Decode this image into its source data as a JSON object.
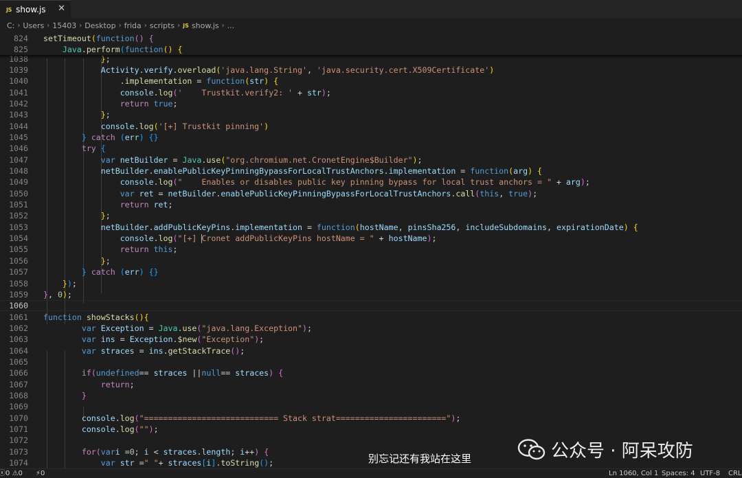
{
  "tab": {
    "badge": "JS",
    "label": "show.js",
    "close": "✕"
  },
  "breadcrumb": [
    "C:",
    "Users",
    "15403",
    "Desktop",
    "frida",
    "scripts",
    "show.js",
    "..."
  ],
  "sticky_lines": [
    {
      "no": "824",
      "tokens": [
        [
          "f",
          "setTimeout"
        ],
        [
          "b1",
          "("
        ],
        [
          "k",
          "function"
        ],
        [
          "b2",
          "()"
        ],
        [
          "p",
          " "
        ],
        [
          "b2",
          "{"
        ]
      ]
    },
    {
      "no": "825",
      "tokens": [
        [
          "p",
          "    "
        ],
        [
          "c",
          "Java"
        ],
        [
          "p",
          "."
        ],
        [
          "f",
          "perform"
        ],
        [
          "b3",
          "("
        ],
        [
          "k",
          "function"
        ],
        [
          "b1",
          "()"
        ],
        [
          "p",
          " "
        ],
        [
          "b1",
          "{"
        ]
      ]
    }
  ],
  "lines": [
    {
      "no": "1038",
      "tokens": [
        [
          "p",
          "            "
        ],
        [
          "b1",
          "}"
        ],
        [
          "p",
          ";"
        ]
      ]
    },
    {
      "no": "1039",
      "tokens": [
        [
          "p",
          "            "
        ],
        [
          "v",
          "Activity"
        ],
        [
          "p",
          "."
        ],
        [
          "v",
          "verify"
        ],
        [
          "p",
          "."
        ],
        [
          "f",
          "overload"
        ],
        [
          "b1",
          "("
        ],
        [
          "s",
          "'java.lang.String'"
        ],
        [
          "p",
          ", "
        ],
        [
          "s",
          "'java.security.cert.X509Certificate'"
        ],
        [
          "b1",
          ")"
        ]
      ]
    },
    {
      "no": "1040",
      "tokens": [
        [
          "p",
          "                ."
        ],
        [
          "f",
          "implementation"
        ],
        [
          "p",
          " = "
        ],
        [
          "k",
          "function"
        ],
        [
          "b1",
          "("
        ],
        [
          "v",
          "str"
        ],
        [
          "b1",
          ")"
        ],
        [
          "p",
          " "
        ],
        [
          "b1",
          "{"
        ]
      ]
    },
    {
      "no": "1041",
      "tokens": [
        [
          "p",
          "                "
        ],
        [
          "v",
          "console"
        ],
        [
          "p",
          "."
        ],
        [
          "f",
          "log"
        ],
        [
          "b2",
          "("
        ],
        [
          "s",
          "'    Trustkit.verify2: '"
        ],
        [
          "p",
          " + "
        ],
        [
          "v",
          "str"
        ],
        [
          "b2",
          ")"
        ],
        [
          "p",
          ";"
        ]
      ]
    },
    {
      "no": "1042",
      "tokens": [
        [
          "p",
          "                "
        ],
        [
          "ct",
          "return"
        ],
        [
          "p",
          " "
        ],
        [
          "k",
          "true"
        ],
        [
          "p",
          ";"
        ]
      ]
    },
    {
      "no": "1043",
      "tokens": [
        [
          "p",
          "            "
        ],
        [
          "b1",
          "}"
        ],
        [
          "p",
          ";"
        ]
      ]
    },
    {
      "no": "1044",
      "tokens": [
        [
          "p",
          "            "
        ],
        [
          "v",
          "console"
        ],
        [
          "p",
          "."
        ],
        [
          "f",
          "log"
        ],
        [
          "b1",
          "("
        ],
        [
          "s",
          "'[+] Trustkit pinning'"
        ],
        [
          "b1",
          ")"
        ]
      ]
    },
    {
      "no": "1045",
      "tokens": [
        [
          "p",
          "        "
        ],
        [
          "b3",
          "}"
        ],
        [
          "p",
          " "
        ],
        [
          "ct",
          "catch"
        ],
        [
          "p",
          " "
        ],
        [
          "b3",
          "("
        ],
        [
          "v",
          "err"
        ],
        [
          "b3",
          ")"
        ],
        [
          "p",
          " "
        ],
        [
          "b3",
          "{}"
        ]
      ]
    },
    {
      "no": "1046",
      "tokens": [
        [
          "p",
          "        "
        ],
        [
          "ct",
          "try"
        ],
        [
          "p",
          " "
        ],
        [
          "b3",
          "{"
        ]
      ]
    },
    {
      "no": "1047",
      "tokens": [
        [
          "p",
          "            "
        ],
        [
          "k",
          "var"
        ],
        [
          "p",
          " "
        ],
        [
          "v",
          "netBuilder"
        ],
        [
          "p",
          " = "
        ],
        [
          "c",
          "Java"
        ],
        [
          "p",
          "."
        ],
        [
          "f",
          "use"
        ],
        [
          "b1",
          "("
        ],
        [
          "s",
          "\"org.chromium.net.CronetEngine$Builder\""
        ],
        [
          "b1",
          ")"
        ],
        [
          "p",
          ";"
        ]
      ]
    },
    {
      "no": "1048",
      "tokens": [
        [
          "p",
          "            "
        ],
        [
          "v",
          "netBuilder"
        ],
        [
          "p",
          "."
        ],
        [
          "v",
          "enablePublicKeyPinningBypassForLocalTrustAnchors"
        ],
        [
          "p",
          "."
        ],
        [
          "v",
          "implementation"
        ],
        [
          "p",
          " = "
        ],
        [
          "k",
          "function"
        ],
        [
          "b1",
          "("
        ],
        [
          "v",
          "arg"
        ],
        [
          "b1",
          ")"
        ],
        [
          "p",
          " "
        ],
        [
          "b1",
          "{"
        ]
      ]
    },
    {
      "no": "1049",
      "tokens": [
        [
          "p",
          "                "
        ],
        [
          "v",
          "console"
        ],
        [
          "p",
          "."
        ],
        [
          "f",
          "log"
        ],
        [
          "b2",
          "("
        ],
        [
          "s",
          "\"    Enables or disables public key pinning bypass for local trust anchors = \""
        ],
        [
          "p",
          " + "
        ],
        [
          "v",
          "arg"
        ],
        [
          "b2",
          ")"
        ],
        [
          "p",
          ";"
        ]
      ]
    },
    {
      "no": "1050",
      "tokens": [
        [
          "p",
          "                "
        ],
        [
          "k",
          "var"
        ],
        [
          "p",
          " "
        ],
        [
          "v",
          "ret"
        ],
        [
          "p",
          " = "
        ],
        [
          "v",
          "netBuilder"
        ],
        [
          "p",
          "."
        ],
        [
          "v",
          "enablePublicKeyPinningBypassForLocalTrustAnchors"
        ],
        [
          "p",
          "."
        ],
        [
          "f",
          "call"
        ],
        [
          "b2",
          "("
        ],
        [
          "k",
          "this"
        ],
        [
          "p",
          ", "
        ],
        [
          "k",
          "true"
        ],
        [
          "b2",
          ")"
        ],
        [
          "p",
          ";"
        ]
      ]
    },
    {
      "no": "1051",
      "tokens": [
        [
          "p",
          "                "
        ],
        [
          "ct",
          "return"
        ],
        [
          "p",
          " "
        ],
        [
          "v",
          "ret"
        ],
        [
          "p",
          ";"
        ]
      ]
    },
    {
      "no": "1052",
      "tokens": [
        [
          "p",
          "            "
        ],
        [
          "b1",
          "}"
        ],
        [
          "p",
          ";"
        ]
      ]
    },
    {
      "no": "1053",
      "tokens": [
        [
          "p",
          "            "
        ],
        [
          "v",
          "netBuilder"
        ],
        [
          "p",
          "."
        ],
        [
          "v",
          "addPublicKeyPins"
        ],
        [
          "p",
          "."
        ],
        [
          "v",
          "implementation"
        ],
        [
          "p",
          " = "
        ],
        [
          "k",
          "function"
        ],
        [
          "b1",
          "("
        ],
        [
          "v",
          "hostName"
        ],
        [
          "p",
          ", "
        ],
        [
          "v",
          "pinsSha256"
        ],
        [
          "p",
          ", "
        ],
        [
          "v",
          "includeSubdomains"
        ],
        [
          "p",
          ", "
        ],
        [
          "v",
          "expirationDate"
        ],
        [
          "b1",
          ")"
        ],
        [
          "p",
          " "
        ],
        [
          "b1",
          "{"
        ]
      ]
    },
    {
      "no": "1054",
      "tokens": [
        [
          "p",
          "                "
        ],
        [
          "v",
          "console"
        ],
        [
          "p",
          "."
        ],
        [
          "f",
          "log"
        ],
        [
          "b2",
          "("
        ],
        [
          "s",
          "\"[+] "
        ],
        [
          "caret",
          ""
        ],
        [
          "s",
          "Cronet addPublicKeyPins hostName = \""
        ],
        [
          "p",
          " + "
        ],
        [
          "v",
          "hostName"
        ],
        [
          "b2",
          ")"
        ],
        [
          "p",
          ";"
        ]
      ]
    },
    {
      "no": "1055",
      "tokens": [
        [
          "p",
          "                "
        ],
        [
          "ct",
          "return"
        ],
        [
          "p",
          " "
        ],
        [
          "k",
          "this"
        ],
        [
          "p",
          ";"
        ]
      ]
    },
    {
      "no": "1056",
      "tokens": [
        [
          "p",
          "            "
        ],
        [
          "b1",
          "}"
        ],
        [
          "p",
          ";"
        ]
      ]
    },
    {
      "no": "1057",
      "tokens": [
        [
          "p",
          "        "
        ],
        [
          "b3",
          "}"
        ],
        [
          "p",
          " "
        ],
        [
          "ct",
          "catch"
        ],
        [
          "p",
          " "
        ],
        [
          "b3",
          "("
        ],
        [
          "v",
          "err"
        ],
        [
          "b3",
          ")"
        ],
        [
          "p",
          " "
        ],
        [
          "b3",
          "{}"
        ]
      ]
    },
    {
      "no": "1058",
      "tokens": [
        [
          "p",
          "    "
        ],
        [
          "b1",
          "}"
        ],
        [
          "b3",
          ")"
        ],
        [
          "p",
          ";"
        ]
      ]
    },
    {
      "no": "1059",
      "tokens": [
        [
          "b2",
          "}"
        ],
        [
          "p",
          ", "
        ],
        [
          "n",
          "0"
        ],
        [
          "b1",
          ")"
        ],
        [
          "p",
          ";"
        ]
      ]
    },
    {
      "no": "1060",
      "tokens": [],
      "active": true
    },
    {
      "no": "1061",
      "tokens": [
        [
          "k",
          "function"
        ],
        [
          "p",
          " "
        ],
        [
          "f",
          "showStacks"
        ],
        [
          "b1",
          "()"
        ],
        [
          "b1",
          "{"
        ]
      ]
    },
    {
      "no": "1062",
      "tokens": [
        [
          "p",
          "        "
        ],
        [
          "k",
          "var"
        ],
        [
          "p",
          " "
        ],
        [
          "v",
          "Exception"
        ],
        [
          "p",
          " = "
        ],
        [
          "c",
          "Java"
        ],
        [
          "p",
          "."
        ],
        [
          "f",
          "use"
        ],
        [
          "b2",
          "("
        ],
        [
          "s",
          "\"java.lang.Exception\""
        ],
        [
          "b2",
          ")"
        ],
        [
          "p",
          ";"
        ]
      ]
    },
    {
      "no": "1063",
      "tokens": [
        [
          "p",
          "        "
        ],
        [
          "k",
          "var"
        ],
        [
          "p",
          " "
        ],
        [
          "v",
          "ins"
        ],
        [
          "p",
          " = "
        ],
        [
          "v",
          "Exception"
        ],
        [
          "p",
          "."
        ],
        [
          "f",
          "$new"
        ],
        [
          "b2",
          "("
        ],
        [
          "s",
          "\"Exception\""
        ],
        [
          "b2",
          ")"
        ],
        [
          "p",
          ";"
        ]
      ]
    },
    {
      "no": "1064",
      "tokens": [
        [
          "p",
          "        "
        ],
        [
          "k",
          "var"
        ],
        [
          "p",
          " "
        ],
        [
          "v",
          "straces"
        ],
        [
          "p",
          " = "
        ],
        [
          "v",
          "ins"
        ],
        [
          "p",
          "."
        ],
        [
          "f",
          "getStackTrace"
        ],
        [
          "b2",
          "()"
        ],
        [
          "p",
          ";"
        ]
      ]
    },
    {
      "no": "1065",
      "tokens": []
    },
    {
      "no": "1066",
      "tokens": [
        [
          "p",
          "        "
        ],
        [
          "ct",
          "if"
        ],
        [
          "b2",
          "("
        ],
        [
          "k",
          "undefined"
        ],
        [
          "p",
          "== "
        ],
        [
          "v",
          "straces"
        ],
        [
          "p",
          " ||"
        ],
        [
          "k",
          "null"
        ],
        [
          "p",
          "== "
        ],
        [
          "v",
          "straces"
        ],
        [
          "b2",
          ")"
        ],
        [
          "p",
          " "
        ],
        [
          "b2",
          "{"
        ]
      ]
    },
    {
      "no": "1067",
      "tokens": [
        [
          "p",
          "            "
        ],
        [
          "ct",
          "return"
        ],
        [
          "p",
          ";"
        ]
      ]
    },
    {
      "no": "1068",
      "tokens": [
        [
          "p",
          "        "
        ],
        [
          "b2",
          "}"
        ]
      ]
    },
    {
      "no": "1069",
      "tokens": []
    },
    {
      "no": "1070",
      "tokens": [
        [
          "p",
          "        "
        ],
        [
          "v",
          "console"
        ],
        [
          "p",
          "."
        ],
        [
          "f",
          "log"
        ],
        [
          "b2",
          "("
        ],
        [
          "s",
          "\"============================ Stack strat=======================\""
        ],
        [
          "b2",
          ")"
        ],
        [
          "p",
          ";"
        ]
      ]
    },
    {
      "no": "1071",
      "tokens": [
        [
          "p",
          "        "
        ],
        [
          "v",
          "console"
        ],
        [
          "p",
          "."
        ],
        [
          "f",
          "log"
        ],
        [
          "b2",
          "("
        ],
        [
          "s",
          "\"\""
        ],
        [
          "b2",
          ")"
        ],
        [
          "p",
          ";"
        ]
      ]
    },
    {
      "no": "1072",
      "tokens": []
    },
    {
      "no": "1073",
      "tokens": [
        [
          "p",
          "        "
        ],
        [
          "ct",
          "for"
        ],
        [
          "b2",
          "("
        ],
        [
          "k",
          "var"
        ],
        [
          "v",
          "i"
        ],
        [
          "p",
          " ="
        ],
        [
          "n",
          "0"
        ],
        [
          "p",
          "; "
        ],
        [
          "v",
          "i"
        ],
        [
          "p",
          " < "
        ],
        [
          "v",
          "straces"
        ],
        [
          "p",
          "."
        ],
        [
          "v",
          "length"
        ],
        [
          "p",
          "; "
        ],
        [
          "v",
          "i"
        ],
        [
          "p",
          "++"
        ],
        [
          "b2",
          ")"
        ],
        [
          "p",
          " "
        ],
        [
          "b2",
          "{"
        ]
      ]
    },
    {
      "no": "1074",
      "tokens": [
        [
          "p",
          "            "
        ],
        [
          "k",
          "var"
        ],
        [
          "p",
          " "
        ],
        [
          "v",
          "str"
        ],
        [
          "p",
          " ="
        ],
        [
          "s",
          "\" \""
        ],
        [
          "p",
          "+ "
        ],
        [
          "v",
          "straces"
        ],
        [
          "b3",
          "["
        ],
        [
          "v",
          "i"
        ],
        [
          "b3",
          "]"
        ],
        [
          "p",
          "."
        ],
        [
          "f",
          "toString"
        ],
        [
          "b3",
          "()"
        ],
        [
          "p",
          ";"
        ]
      ]
    }
  ],
  "status": {
    "errors": "0",
    "warnings": "0",
    "ports": "0",
    "position": "Ln 1060, Col 1",
    "spaces": "Spaces: 4",
    "encoding": "UTF-8",
    "eol": "CRLF"
  },
  "watermark": {
    "caption": "别忘记还有我站在这里",
    "brand": "公众号 · 阿呆攻防",
    "icon": "wechat-icon"
  },
  "colors": {
    "background": "#1e1e1e",
    "keyword": "#569cd6",
    "control": "#c586c0",
    "function": "#dcdcaa",
    "variable": "#9cdcfe",
    "string": "#ce9178",
    "number": "#b5cea8",
    "class": "#4ec9b0"
  }
}
